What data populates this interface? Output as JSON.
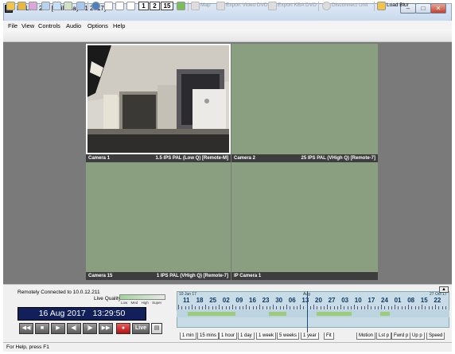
{
  "window": {
    "title": "PCLink 200 [Built May 31 2017]"
  },
  "menu": [
    "File",
    "View",
    "Controls",
    "Audio",
    "Options",
    "Help"
  ],
  "toolbar": {
    "numbers": [
      "1",
      "2",
      "15"
    ],
    "map": "Map",
    "export_video_dvd": "Export Video DVD",
    "export_kba_dvd": "Export KBA DVD",
    "disconnect_unit": "Disconnect Unit",
    "load_blur": "Load Blur"
  },
  "cameras": [
    {
      "name": "Camera 1",
      "info": "1.5 IPS PAL (Low Q) [Remote-M]"
    },
    {
      "name": "Camera 2",
      "info": "25 IPS PAL (VHigh Q) [Remote-7]"
    },
    {
      "name": "Camera 15",
      "info": "1 IPS PAL (VHigh Q) [Remote-7]"
    },
    {
      "name": "IP Camera 1",
      "info": ""
    }
  ],
  "panel": {
    "connection": "Remotely Connected to 10.0.12.211",
    "live_quality_label": "Live Quality:",
    "quality_scale": [
      "Low",
      "Med",
      "High",
      "Super"
    ],
    "date": "16 Aug 2017",
    "time": "13:29:50",
    "live_label": "Live"
  },
  "timeline": {
    "start_label": "10 Jun 17",
    "end_label": "27 Oct 17",
    "cursor_label": "Aug",
    "days": [
      "11",
      "18",
      "25",
      "02",
      "09",
      "16",
      "23",
      "30",
      "06",
      "13",
      "20",
      "27",
      "03",
      "10",
      "17",
      "24",
      "01",
      "08",
      "15",
      "22"
    ],
    "zoom_tabs": [
      "1 min",
      "15 mins",
      "1 hour",
      "1 day",
      "1 week",
      "5 weeks",
      "1 year",
      "Fit"
    ],
    "nav_tabs": [
      "Motion",
      "Lst p",
      "Fwrd p",
      "Up p",
      "Speed"
    ]
  },
  "status": {
    "text": "For Help, press F1"
  },
  "colors": {
    "clock_bg": "#11205a",
    "tile_bg": "#8a9e80",
    "record": "#d21b1b"
  }
}
